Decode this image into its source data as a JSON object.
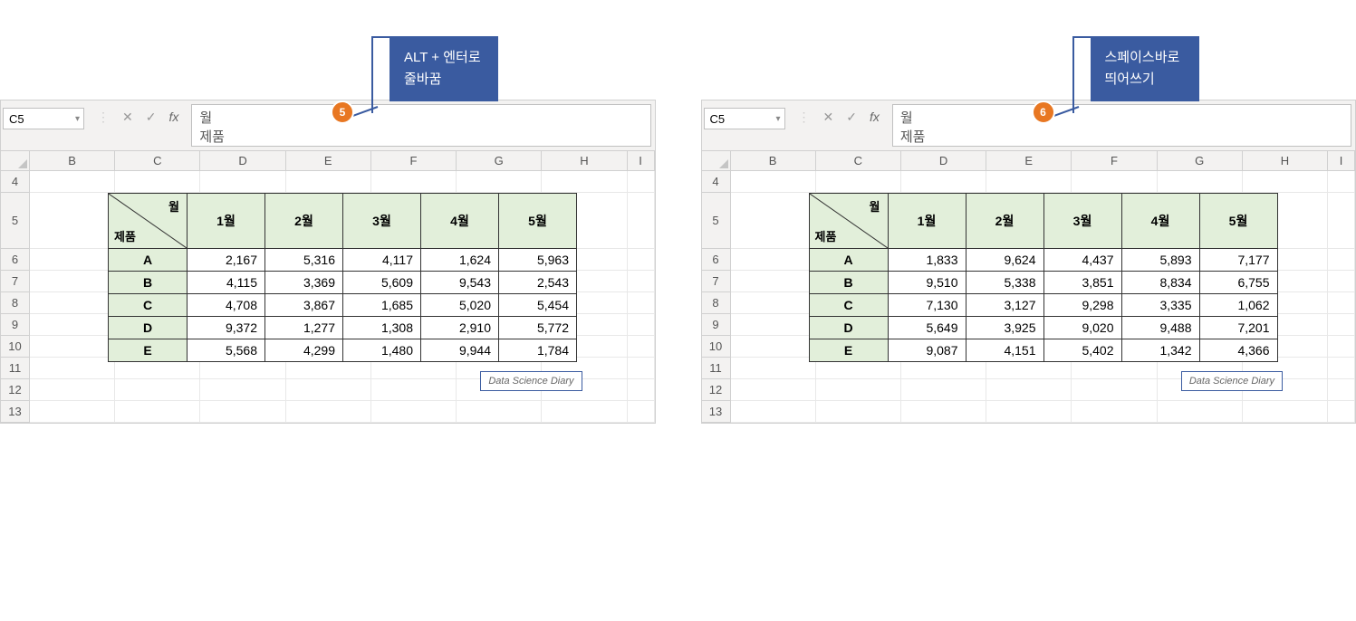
{
  "panels": [
    {
      "callout": {
        "lines": [
          "ALT + 엔터로",
          "줄바꿈"
        ],
        "badge": "5"
      },
      "name_box": "C5",
      "formula_bar": "월\n제품",
      "col_headers": [
        "B",
        "C",
        "D",
        "E",
        "F",
        "G",
        "H",
        "I"
      ],
      "row_headers": [
        "4",
        "5",
        "6",
        "7",
        "8",
        "9",
        "10",
        "11",
        "12",
        "13"
      ],
      "diag": {
        "top": "월",
        "bottom": "제품"
      },
      "months": [
        "1월",
        "2월",
        "3월",
        "4월",
        "5월"
      ],
      "products": [
        "A",
        "B",
        "C",
        "D",
        "E"
      ],
      "values": [
        [
          "2,167",
          "5,316",
          "4,117",
          "1,624",
          "5,963"
        ],
        [
          "4,115",
          "3,369",
          "5,609",
          "9,543",
          "2,543"
        ],
        [
          "4,708",
          "3,867",
          "1,685",
          "5,020",
          "5,454"
        ],
        [
          "9,372",
          "1,277",
          "1,308",
          "2,910",
          "5,772"
        ],
        [
          "5,568",
          "4,299",
          "1,480",
          "9,944",
          "1,784"
        ]
      ],
      "watermark": "Data Science Diary"
    },
    {
      "callout": {
        "lines": [
          "스페이스바로",
          "띄어쓰기"
        ],
        "badge": "6"
      },
      "name_box": "C5",
      "formula_bar": "            월\n제품",
      "col_headers": [
        "B",
        "C",
        "D",
        "E",
        "F",
        "G",
        "H",
        "I"
      ],
      "row_headers": [
        "4",
        "5",
        "6",
        "7",
        "8",
        "9",
        "10",
        "11",
        "12",
        "13"
      ],
      "diag": {
        "top": "월",
        "bottom": "제품"
      },
      "months": [
        "1월",
        "2월",
        "3월",
        "4월",
        "5월"
      ],
      "products": [
        "A",
        "B",
        "C",
        "D",
        "E"
      ],
      "values": [
        [
          "1,833",
          "9,624",
          "4,437",
          "5,893",
          "7,177"
        ],
        [
          "9,510",
          "5,338",
          "3,851",
          "8,834",
          "6,755"
        ],
        [
          "7,130",
          "3,127",
          "9,298",
          "3,335",
          "1,062"
        ],
        [
          "5,649",
          "3,925",
          "9,020",
          "9,488",
          "7,201"
        ],
        [
          "9,087",
          "4,151",
          "5,402",
          "1,342",
          "4,366"
        ]
      ],
      "watermark": "Data Science Diary"
    }
  ]
}
